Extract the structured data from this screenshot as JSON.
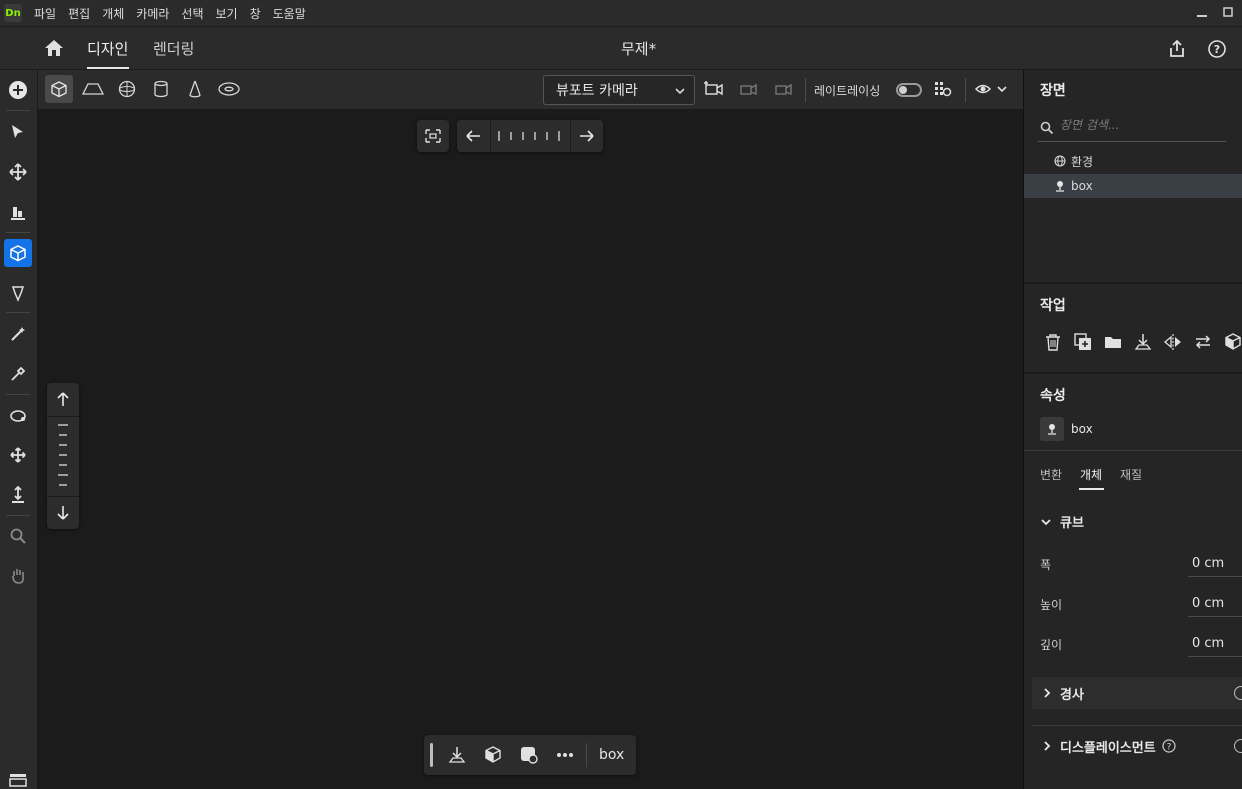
{
  "app": {
    "logo_text": "Dn"
  },
  "menu": [
    "파일",
    "편집",
    "개체",
    "카메라",
    "선택",
    "보기",
    "창",
    "도움말"
  ],
  "header": {
    "tabs": [
      "디자인",
      "렌더링"
    ],
    "doc_title": "무제*"
  },
  "primitive_bar": {
    "camera_select": "뷰포트 카메라",
    "raytracing_label": "레이트레이싱"
  },
  "bottom_bar": {
    "object_name": "box"
  },
  "scene_panel": {
    "title": "장면",
    "search_placeholder": "장면 검색...",
    "items": [
      {
        "label": "환경",
        "icon": "globe-icon"
      },
      {
        "label": "box",
        "icon": "object-icon"
      }
    ]
  },
  "actions_panel": {
    "title": "작업"
  },
  "properties_panel": {
    "title": "속성",
    "object_name": "box",
    "tabs": [
      "변환",
      "개체",
      "재질"
    ],
    "section": "큐브",
    "rows": [
      {
        "label": "폭",
        "value": "0 cm"
      },
      {
        "label": "높이",
        "value": "0 cm"
      },
      {
        "label": "깊이",
        "value": "0 cm"
      }
    ],
    "collapsed_sections": [
      "경사",
      "디스플레이스먼트"
    ]
  },
  "colors": {
    "accent": "#1473e6",
    "logo_green": "#8ef000"
  }
}
